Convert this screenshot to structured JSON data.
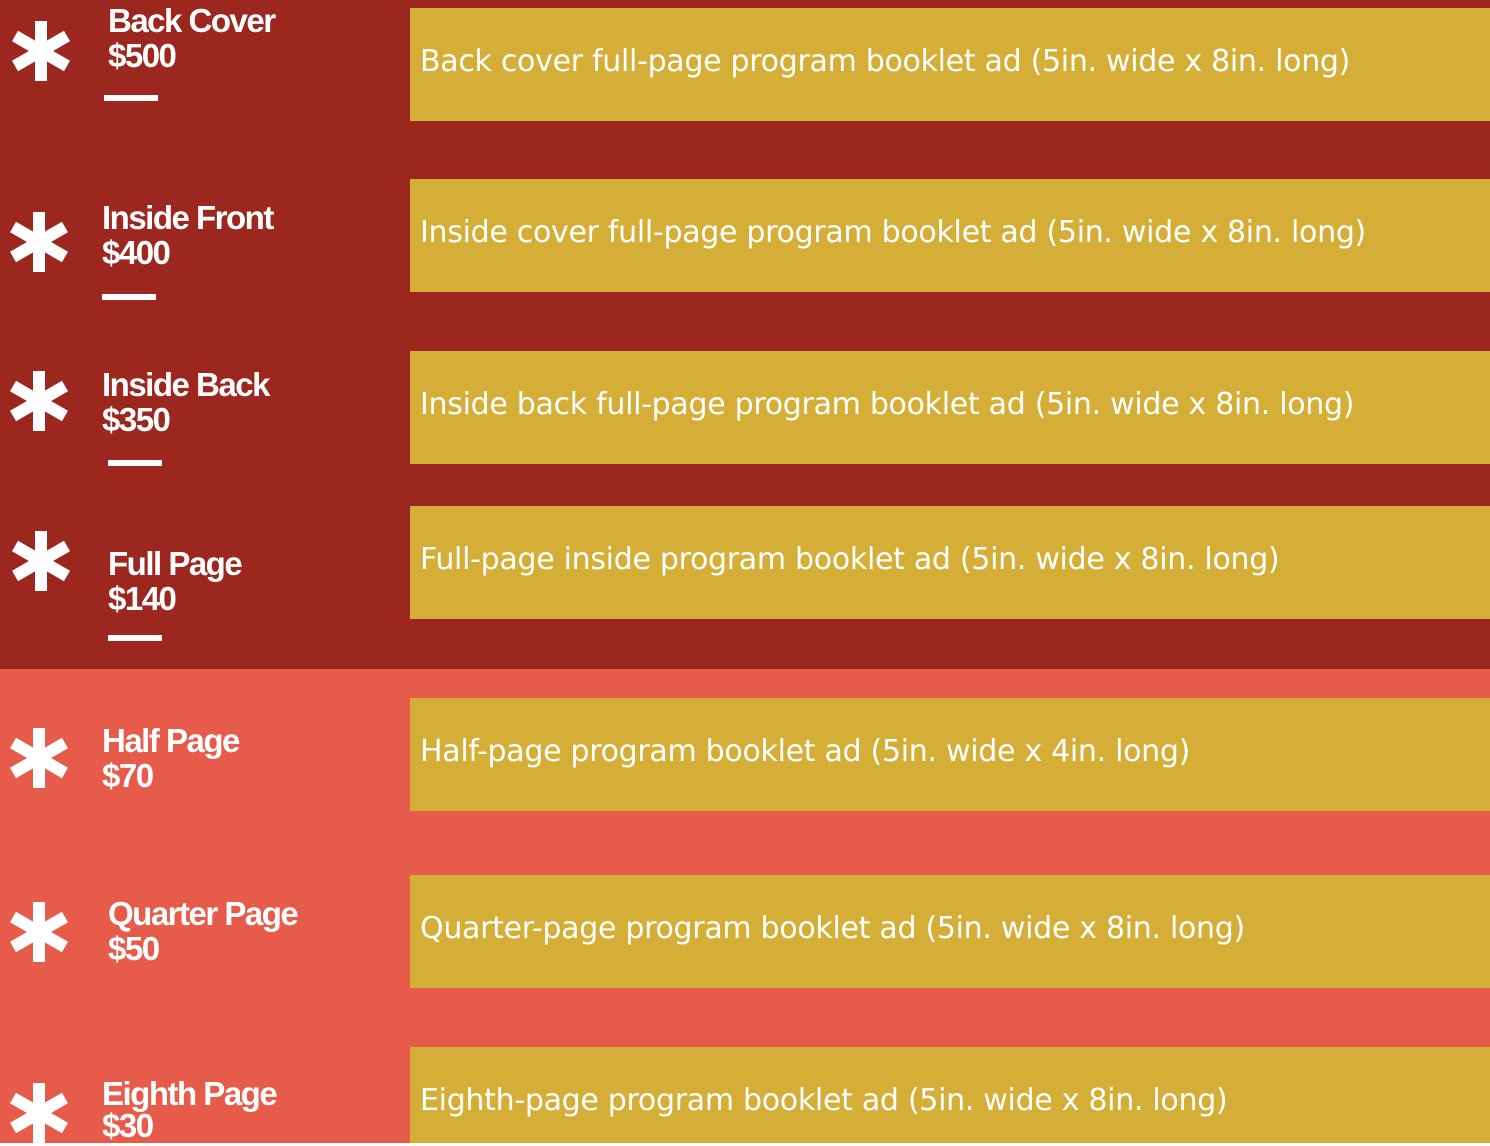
{
  "colors": {
    "premium_band": "#9c271f",
    "standard_band": "#e65b49",
    "description_box": "#d4ae36",
    "text": "#ffffff"
  },
  "ads": [
    {
      "name": "Back Cover",
      "price": "$500",
      "description": "Back cover full-page program booklet ad (5in. wide x 8in. long)",
      "icon": "asterisk-icon"
    },
    {
      "name": "Inside Front",
      "price": "$400",
      "description": "Inside cover full-page program booklet ad (5in. wide x 8in. long)",
      "icon": "asterisk-icon"
    },
    {
      "name": "Inside Back",
      "price": "$350",
      "description": "Inside back full-page program booklet ad (5in. wide x 8in. long)",
      "icon": "asterisk-icon"
    },
    {
      "name": "Full Page",
      "price": "$140",
      "description": "Full-page inside program booklet ad (5in. wide x 8in. long)",
      "icon": "asterisk-icon"
    },
    {
      "name": "Half Page",
      "price": "$70",
      "description": "Half-page program booklet ad (5in. wide x 4in. long)",
      "icon": "asterisk-icon"
    },
    {
      "name": "Quarter Page",
      "price": "$50",
      "description": "Quarter-page program booklet ad (5in. wide x 8in. long)",
      "icon": "asterisk-icon"
    },
    {
      "name": "Eighth Page",
      "price": "$30",
      "description": "Eighth-page program booklet ad (5in. wide x 8in. long)",
      "icon": "asterisk-icon"
    }
  ]
}
